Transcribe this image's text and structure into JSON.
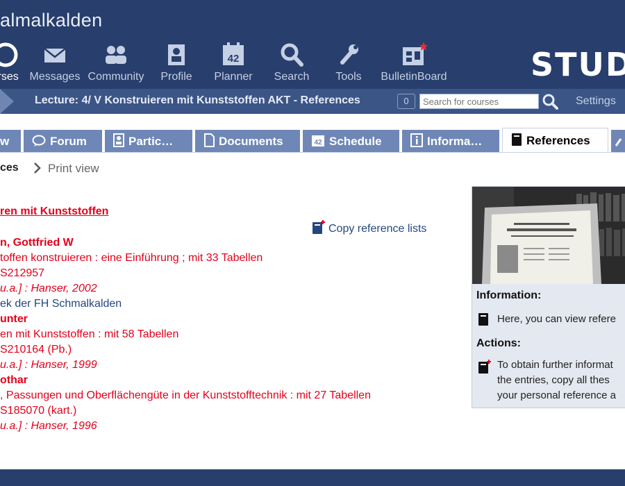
{
  "site": {
    "title": "almalkalden",
    "brand": "STUD"
  },
  "nav": [
    {
      "label": "Courses",
      "icon": "courses-icon"
    },
    {
      "label": "Messages",
      "icon": "envelope-icon"
    },
    {
      "label": "Community",
      "icon": "community-icon"
    },
    {
      "label": "Profile",
      "icon": "profile-icon"
    },
    {
      "label": "Planner",
      "icon": "calendar-icon",
      "day": "42"
    },
    {
      "label": "Search",
      "icon": "search-icon"
    },
    {
      "label": "Tools",
      "icon": "wrench-icon"
    },
    {
      "label": "BulletinBoard",
      "icon": "bulletinboard-icon"
    }
  ],
  "breadcrumb": {
    "title": "Lecture: 4/ V Konstruieren mit Kunststoffen AKT - References"
  },
  "header_tools": {
    "count": "0",
    "search_placeholder": "Search for courses",
    "settings": "Settings"
  },
  "tabs": [
    {
      "label": "w"
    },
    {
      "label": "Forum"
    },
    {
      "label": "Partic…"
    },
    {
      "label": "Documents"
    },
    {
      "label": "Schedule",
      "day": "42"
    },
    {
      "label": "Informa…"
    },
    {
      "label": "References"
    }
  ],
  "subnav": {
    "current": "ces",
    "print": "Print view"
  },
  "content": {
    "list_title": "ren mit Kunststoffen",
    "copy_link": "Copy reference lists",
    "entries": [
      {
        "author": "n, Gottfried W",
        "title": "toffen konstruieren : eine Einführung ; mit 33 Tabellen",
        "isbn": "S212957",
        "pub": "u.a.] : Hanser, 2002",
        "library": "ek der FH Schmalkalden"
      },
      {
        "author": "unter",
        "title": "en mit Kunststoffen : mit 58 Tabellen",
        "isbn": "S210164 (Pb.)",
        "pub": "u.a.] : Hanser, 1999"
      },
      {
        "author": "othar",
        "title": ", Passungen und Oberflächengüte in der Kunststofftechnik : mit 27 Tabellen",
        "isbn": "S185070 (kart.)",
        "pub": "u.a.] : Hanser, 1996"
      }
    ]
  },
  "sidebar": {
    "info_heading": "Information:",
    "info_text": "Here, you can view refere",
    "actions_heading": "Actions:",
    "action_lines": [
      "To obtain further informat",
      "the entries, copy all thes",
      "your personal reference a"
    ]
  }
}
